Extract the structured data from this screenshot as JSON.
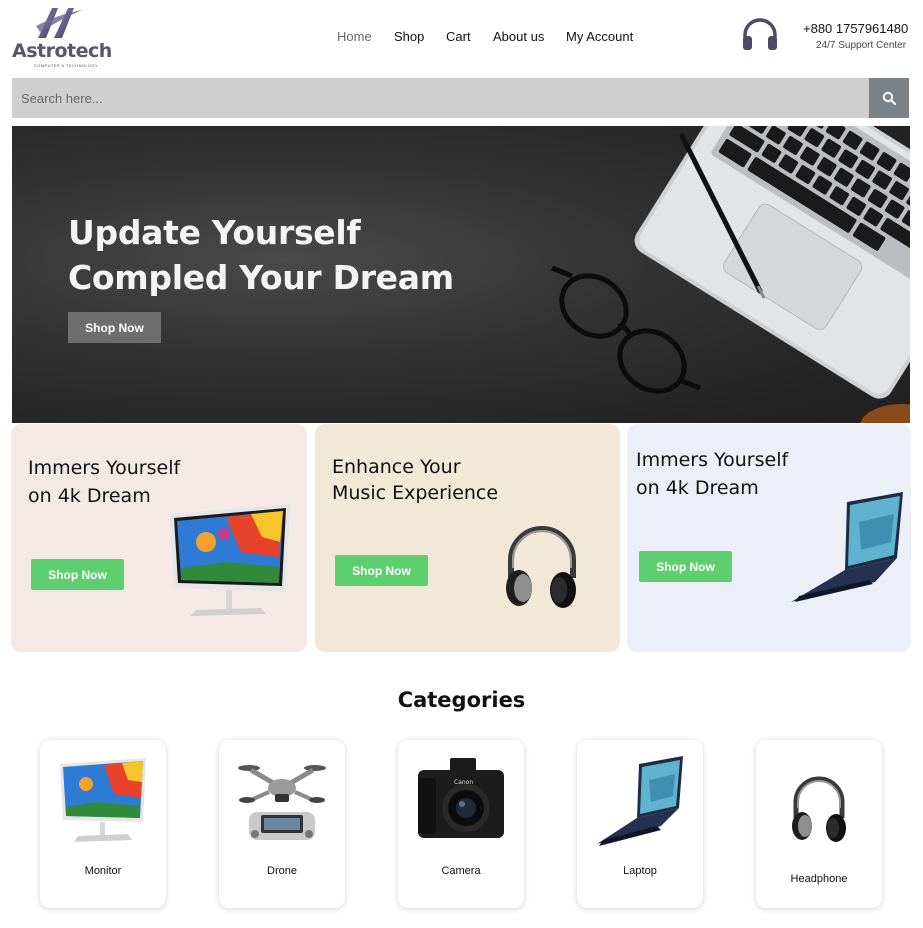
{
  "brand": {
    "name": "Astrotech",
    "tagline": "COMPUTER & TECHNOLOGY"
  },
  "nav": {
    "items": [
      "Home",
      "Shop",
      "Cart",
      "About us",
      "My Account"
    ]
  },
  "support": {
    "phone": "+880 1757961480",
    "label": "24/7 Support Center",
    "icon": "headphones-icon"
  },
  "search": {
    "placeholder": "Search here...",
    "value": "",
    "icon": "search-icon"
  },
  "hero": {
    "title_line1": "Update Yourself",
    "title_line2": "Compled Your Dream",
    "button": "Shop Now"
  },
  "promos": [
    {
      "title_line1": "Immers Yourself",
      "title_line2": "on 4k Dream",
      "button": "Shop Now",
      "product": "monitor",
      "bg": "#f5e9e7"
    },
    {
      "title_line1": "Enhance Your",
      "title_line2": "Music Experience",
      "button": "Shop Now",
      "product": "headphone",
      "bg": "#f2e8d8"
    },
    {
      "title_line1": "Immers Yourself",
      "title_line2": "on 4k Dream",
      "button": "Shop Now",
      "product": "laptop",
      "bg": "#eceff8"
    }
  ],
  "categories": {
    "title": "Categories",
    "items": [
      {
        "label": "Monitor"
      },
      {
        "label": "Drone"
      },
      {
        "label": "Camera"
      },
      {
        "label": "Laptop"
      },
      {
        "label": "Headphone"
      }
    ]
  },
  "colors": {
    "accent_green": "#5ecf6e",
    "search_bg": "#cfcfcf",
    "search_btn": "#7b8287",
    "hero_btn": "#6e6e6e"
  }
}
